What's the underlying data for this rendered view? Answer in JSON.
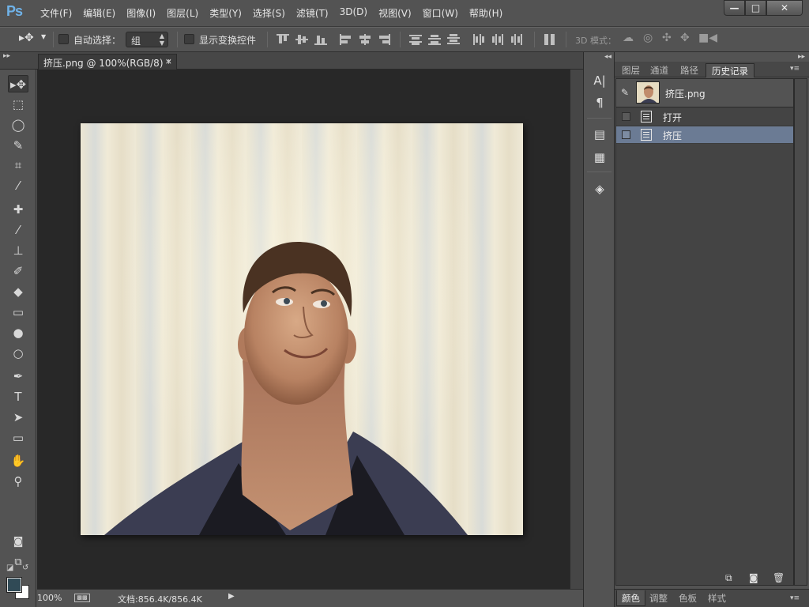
{
  "app": {
    "logo": "Ps"
  },
  "menu": [
    "文件(F)",
    "编辑(E)",
    "图像(I)",
    "图层(L)",
    "类型(Y)",
    "选择(S)",
    "滤镜(T)",
    "3D(D)",
    "视图(V)",
    "窗口(W)",
    "帮助(H)"
  ],
  "window_buttons": {
    "minimize": "—",
    "maximize": "□",
    "close": "✕"
  },
  "options": {
    "auto_select_label": "自动选择：",
    "auto_select_value": "组",
    "show_transform_label": "显示变换控件",
    "mode_3d_label": "3D 模式："
  },
  "document": {
    "tab_title": "挤压.png @ 100%(RGB/8) *",
    "close": "×"
  },
  "status": {
    "zoom": "100%",
    "doc_size": "文档:856.4K/856.4K",
    "arrow": "▶"
  },
  "history_panel": {
    "tabs": [
      "图层",
      "通道",
      "路径",
      "历史记录"
    ],
    "active_tab": "历史记录",
    "snapshot_name": "挤压.png",
    "items": [
      {
        "label": "打开",
        "selected": false
      },
      {
        "label": "挤压",
        "selected": true
      }
    ]
  },
  "bottom_panel": {
    "tabs": [
      "颜色",
      "调整",
      "色板",
      "样式"
    ],
    "active_tab": "颜色"
  },
  "colors": {
    "foreground": "#304a56",
    "background": "#ffffff",
    "selection": "#6b7b94"
  },
  "icons": {
    "tools": [
      "move-tool-icon",
      "marquee-tool-icon",
      "lasso-tool-icon",
      "quick-select-tool-icon",
      "crop-tool-icon",
      "eyedropper-tool-icon",
      "healing-brush-tool-icon",
      "brush-tool-icon",
      "clone-stamp-tool-icon",
      "history-brush-tool-icon",
      "eraser-tool-icon",
      "gradient-tool-icon",
      "blur-tool-icon",
      "dodge-tool-icon",
      "pen-tool-icon",
      "type-tool-icon",
      "path-select-tool-icon",
      "shape-tool-icon",
      "hand-tool-icon",
      "zoom-tool-icon"
    ]
  }
}
